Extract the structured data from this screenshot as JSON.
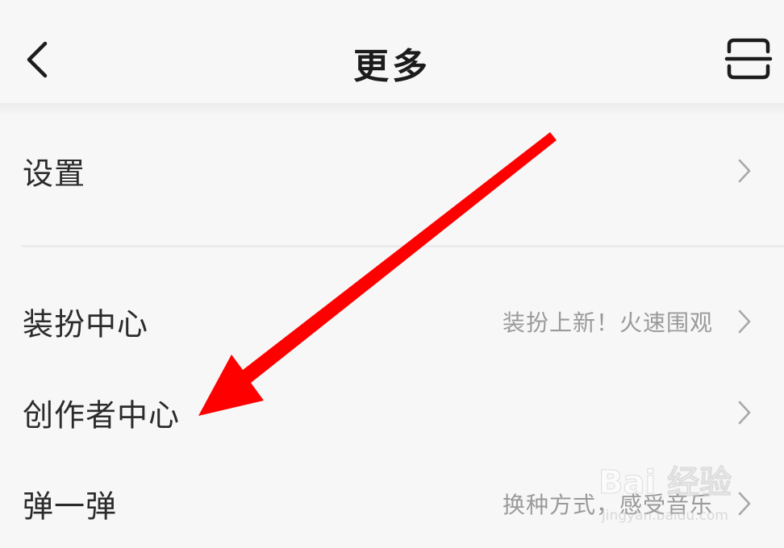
{
  "header": {
    "title": "更多",
    "back_icon": "chevron-left-icon",
    "scan_icon": "scan-icon"
  },
  "menu": {
    "items": [
      {
        "label": "设置",
        "hint": ""
      },
      {
        "label": "装扮中心",
        "hint": "装扮上新！火速围观"
      },
      {
        "label": "创作者中心",
        "hint": ""
      },
      {
        "label": "弹一弹",
        "hint": "换种方式，感受音乐"
      }
    ]
  },
  "annotation": {
    "arrow_color": "#ff0000",
    "target": "创作者中心"
  },
  "watermark": {
    "brand": "Bai 经验",
    "url": "jingyan.baidu.com"
  }
}
